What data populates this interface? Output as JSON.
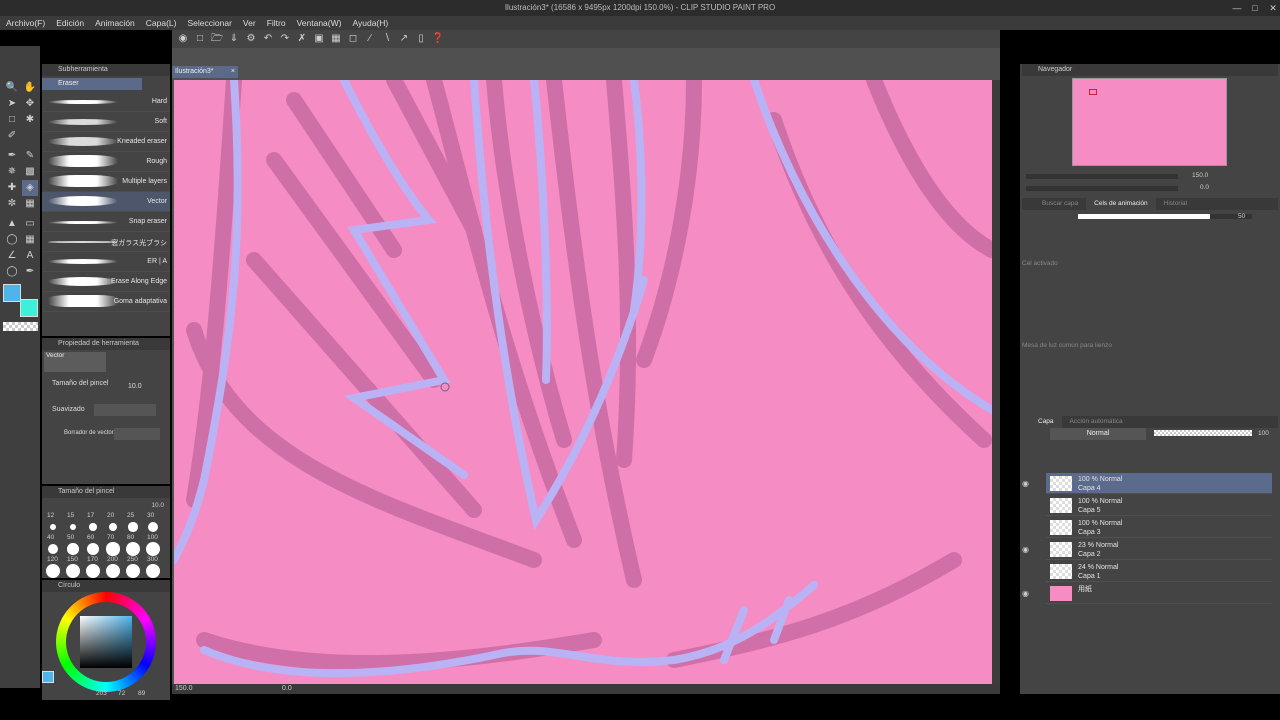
{
  "window": {
    "title": "Ilustración3* (16586 x 9495px 1200dpi 150.0%) - CLIP STUDIO PAINT PRO"
  },
  "menu": [
    "Archivo(F)",
    "Edición",
    "Animación",
    "Capa(L)",
    "Seleccionar",
    "Ver",
    "Filtro",
    "Ventana(W)",
    "Ayuda(H)"
  ],
  "document_tab": "Ilustración3*",
  "sub_tool": {
    "header": "Subherramienta",
    "group": "Eraser",
    "items": [
      "Hard",
      "Soft",
      "Kneaded eraser",
      "Rough",
      "Multiple layers",
      "Vector",
      "Snap eraser",
      "窓ガラス光ブラシ",
      "ER | A",
      "Erase Along Edge",
      "Goma adaptativa"
    ],
    "selected": "Vector"
  },
  "tool_property": {
    "header": "Propiedad de herramienta",
    "preset_name": "Vector",
    "brush_size_label": "Tamaño del pincel",
    "brush_size_value": "10.0",
    "smoothing_label": "Suavizado",
    "vector_eraser_label": "Borrador de vector"
  },
  "brush_size_panel": {
    "header": "Tamaño del pincel",
    "current": "10.0",
    "sizes": [
      "12",
      "15",
      "17",
      "20",
      "25",
      "30",
      "40",
      "50",
      "60",
      "70",
      "80",
      "100",
      "120",
      "150",
      "170",
      "200",
      "250",
      "300"
    ]
  },
  "color_panel": {
    "header": "Círculo",
    "main_color": "#4fb4ea",
    "sub_color": "#3ef0d8",
    "readout": [
      "203",
      "72",
      "89"
    ]
  },
  "canvas": {
    "background_color": "#f68cc4",
    "line_color": "#b9b3f5",
    "shadow_color": "#c96aa3"
  },
  "statusbar": {
    "zoom": "150.0",
    "angle": "0.0"
  },
  "navigator": {
    "header": "Navegador",
    "zoom": "150.0",
    "rotation": "0.0"
  },
  "anim_panel": {
    "tabs": [
      "Buscar capa",
      "Cels de animación",
      "Historial"
    ],
    "opacity_value": "50",
    "cel_label": "Cel activado",
    "footer": "Mesa de luz común para lienzo"
  },
  "layer_panel": {
    "tabs": [
      "Capa",
      "Acción automática"
    ],
    "blend_mode": "Normal",
    "opacity": "100",
    "layers": [
      {
        "pct": "100 %",
        "mode": "Normal",
        "name": "Capa 4",
        "visible": true,
        "selected": true
      },
      {
        "pct": "100 %",
        "mode": "Normal",
        "name": "Capa 5",
        "visible": false,
        "selected": false
      },
      {
        "pct": "100 %",
        "mode": "Normal",
        "name": "Capa 3",
        "visible": false,
        "selected": false
      },
      {
        "pct": "23 %",
        "mode": "Normal",
        "name": "Capa 2",
        "visible": true,
        "selected": false
      },
      {
        "pct": "24 %",
        "mode": "Normal",
        "name": "Capa 1",
        "visible": false,
        "selected": false
      },
      {
        "pct": "",
        "mode": "",
        "name": "用紙",
        "visible": true,
        "selected": false
      }
    ]
  }
}
